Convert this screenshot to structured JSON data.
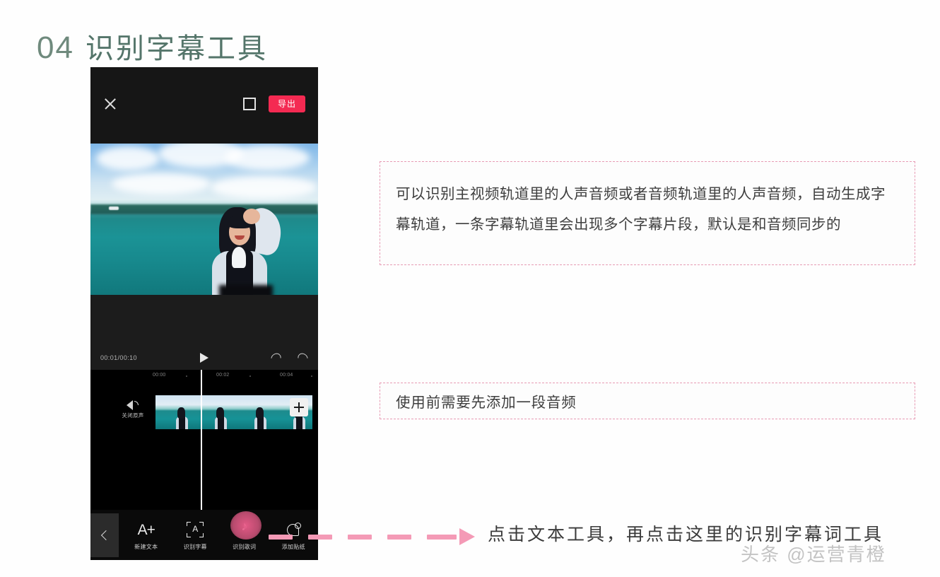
{
  "slide": {
    "number": "04",
    "title": "识别字幕工具"
  },
  "phone": {
    "topbar": {
      "close_icon": "close-x-icon",
      "fullscreen_icon": "fullscreen-expand-icon",
      "export_label": "导出",
      "export_color": "#f42a52"
    },
    "playbar": {
      "time": "00:01/00:10",
      "play_icon": "play-triangle-icon",
      "undo_icon": "undo-arrow-icon",
      "redo_icon": "redo-arrow-icon"
    },
    "ruler": {
      "ticks": [
        "00:00",
        "00:02",
        "00:04"
      ]
    },
    "track": {
      "mute_label": "关闭原声",
      "mute_icon": "speaker-mute-icon",
      "add_icon": "plus-icon"
    },
    "toolbar": {
      "back_icon": "chevron-left-icon",
      "items": [
        {
          "label": "新建文本",
          "icon": "a-plus-text-icon"
        },
        {
          "label": "识别字幕",
          "icon": "bracket-a-subtitle-icon"
        },
        {
          "label": "识别歌词",
          "icon": "music-note-icon"
        },
        {
          "label": "添加贴纸",
          "icon": "sticker-icon"
        }
      ]
    }
  },
  "notes": {
    "main": "可以识别主视频轨道里的人声音频或者音频轨道里的人声音频，自动生成字幕轨道，一条字幕轨道里会出现多个字幕片段，默认是和音频同步的",
    "sub": "使用前需要先添加一段音频",
    "border_color": "#e79bb4"
  },
  "annotation": {
    "text": "点击文本工具，再点击这里的识别字幕词工具",
    "arrow_color": "#f49ab6",
    "arrow_icon": "dashed-right-arrow-icon"
  },
  "watermark": {
    "text": "头条 @运营青橙"
  }
}
